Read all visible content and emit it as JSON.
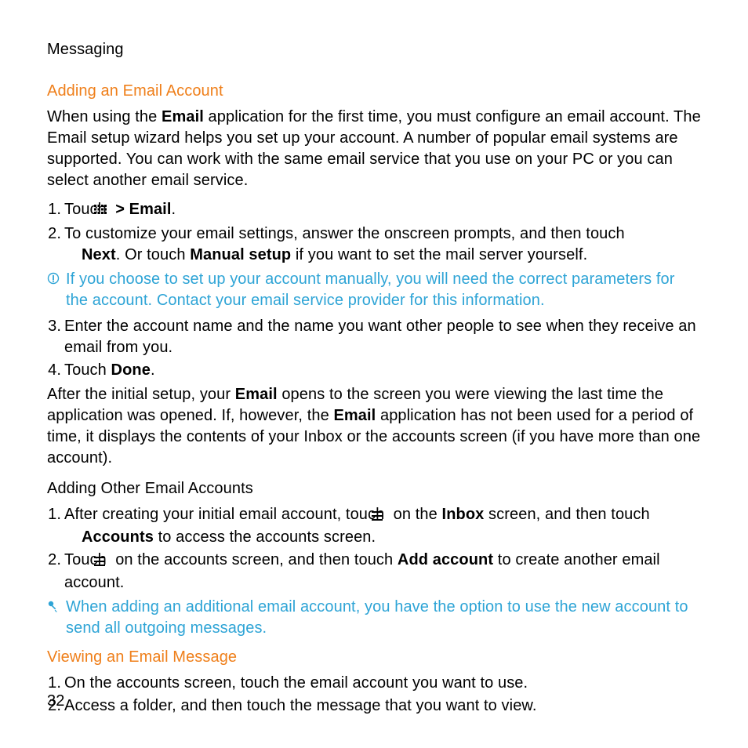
{
  "header": {
    "title": "Messaging"
  },
  "section1": {
    "title": "Adding an Email Account",
    "intro_pre": "When using the ",
    "intro_boldEmail": "Email",
    "intro_post": " application for the first time, you must configure an email account. The Email setup wizard helps you set up your account. A number of popular email systems are supported. You can work with the same email service that you use on your PC or you can select another email service.",
    "step1_pre": "Touch ",
    "step1_mid": " > ",
    "step1_boldEmail": "Email",
    "step1_post": ".",
    "step2_pre": "To customize your email settings, answer the onscreen prompts, and then touch ",
    "step2_boldNext": "Next",
    "step2_mid": ". Or touch ",
    "step2_boldManual": "Manual setup",
    "step2_post": " if you want to set the mail server yourself.",
    "note1": "If you choose to set up your account manually, you will need the correct parameters for the account. Contact your email service provider for this information.",
    "step3": "Enter the account name and the name you want other people to see when they receive an email from you.",
    "step4_pre": "Touch ",
    "step4_boldDone": "Done",
    "step4_post": ".",
    "after_pre": "After the initial setup, your ",
    "after_boldEmail1": "Email",
    "after_mid": " opens to the screen you were viewing the last time the application was opened. If, however, the ",
    "after_boldEmail2": "Email",
    "after_post": " application has not been used for a period of time, it displays the contents of your Inbox or the accounts screen (if you have more than one account)."
  },
  "section2": {
    "subheading": "Adding Other Email Accounts",
    "step1_pre": "After creating your initial email account, touch ",
    "step1_mid": " on the ",
    "step1_boldInbox": "Inbox",
    "step1_mid2": " screen, and then touch ",
    "step1_boldAccounts": "Accounts",
    "step1_post": " to access the accounts screen.",
    "step2_pre": "Touch ",
    "step2_mid": " on the accounts screen, and then touch ",
    "step2_boldAdd": "Add account",
    "step2_post": " to create another email account.",
    "note2": "When adding an additional email account, you have the option to use the new account to send all outgoing messages."
  },
  "section3": {
    "title": "Viewing an Email Message",
    "step1": "On the accounts screen, touch the email account you want to use.",
    "step2": "Access a folder, and then touch the message that you want to view."
  },
  "pageNumber": "32"
}
